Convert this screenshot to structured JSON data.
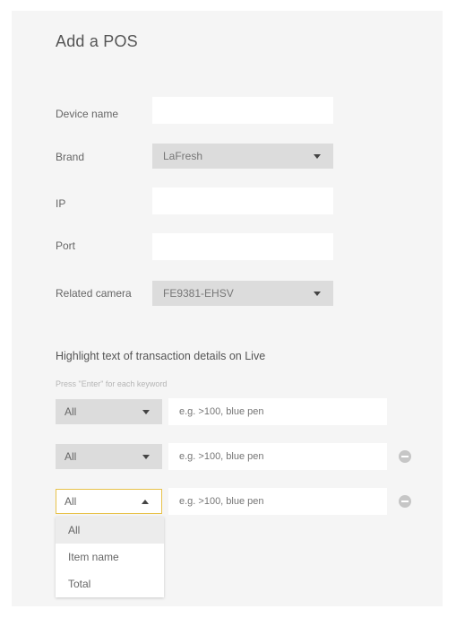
{
  "form": {
    "title": "Add a POS",
    "device_name_label": "Device name",
    "device_name_value": "",
    "brand_label": "Brand",
    "brand_value": "LaFresh",
    "ip_label": "IP",
    "ip_value": "",
    "port_label": "Port",
    "port_value": "",
    "camera_label": "Related camera",
    "camera_value": "FE9381-EHSV"
  },
  "highlight": {
    "section_title": "Highlight text of transaction details on Live",
    "hint": "Press \"Enter\" for each keyword",
    "rows": [
      {
        "scope": "All",
        "placeholder": "e.g. >100, blue pen"
      },
      {
        "scope": "All",
        "placeholder": "e.g. >100, blue pen"
      },
      {
        "scope": "All",
        "placeholder": "e.g. >100, blue pen"
      }
    ],
    "dropdown_options": [
      "All",
      "Item name",
      "Total"
    ],
    "selected_option": "All"
  },
  "colors": {
    "panel_bg": "#f5f5f5",
    "select_bg": "#dcdcdc",
    "focus_border": "#e8c24a"
  },
  "icons": {
    "caret_down": "caret-down-icon",
    "caret_up": "caret-up-icon",
    "remove": "minus-circle-icon"
  }
}
